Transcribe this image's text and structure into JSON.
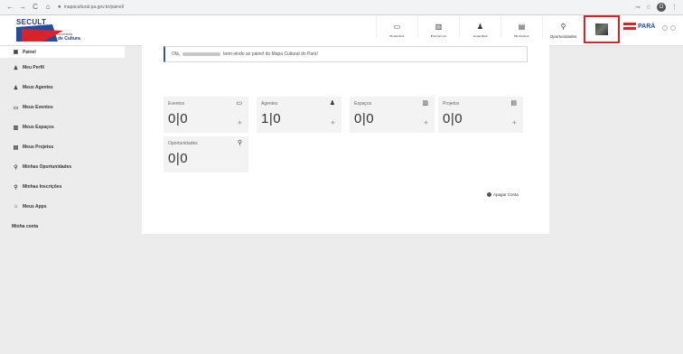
{
  "browser": {
    "url": "mapacultural.pa.gov.br/painel/",
    "nav": [
      "←",
      "→",
      "C",
      "⌂"
    ],
    "profile_initial": "O"
  },
  "header": {
    "logo_title": "SECULT",
    "logo_sub1": "Secretaria",
    "logo_sub2": "de Cultura",
    "nav": [
      {
        "label": "Eventos",
        "icon": "calendar-icon",
        "glyph": "▭"
      },
      {
        "label": "Espaços",
        "icon": "building-icon",
        "glyph": "▥"
      },
      {
        "label": "Agentes",
        "icon": "person-icon",
        "glyph": "♟"
      },
      {
        "label": "Projetos",
        "icon": "document-icon",
        "glyph": "▤"
      },
      {
        "label": "Oportunidades",
        "icon": "lightbulb-icon",
        "glyph": "⚲"
      }
    ],
    "state_logo": "PARÁ"
  },
  "sidebar": {
    "items": [
      {
        "label": "Painel",
        "icon": "dashboard-icon",
        "glyph": "▣"
      },
      {
        "label": "Meu Perfil",
        "icon": "person-icon",
        "glyph": "♟"
      },
      {
        "label": "Meus Agentes",
        "icon": "people-icon",
        "glyph": "♟"
      },
      {
        "label": "Meus Eventos",
        "icon": "calendar-icon",
        "glyph": "▭"
      },
      {
        "label": "Meus Espaços",
        "icon": "building-icon",
        "glyph": "▥"
      },
      {
        "label": "Meus Projetos",
        "icon": "document-icon",
        "glyph": "▤"
      },
      {
        "label": "Minhas Oportunidades",
        "icon": "lightbulb-icon",
        "glyph": "⚲"
      },
      {
        "label": "Minhas Inscrições",
        "icon": "lightbulb-icon",
        "glyph": "⚲"
      },
      {
        "label": "Meus Apps",
        "icon": "app-icon",
        "glyph": "⌂"
      },
      {
        "label": "Minha conta",
        "icon": "",
        "glyph": ""
      }
    ]
  },
  "welcome": {
    "prefix": "Olá,",
    "suffix": "bem-vindo ao painel do Mapa Cultural do Pará!"
  },
  "cards": [
    {
      "title": "Eventos",
      "value": "0|0",
      "icon": "calendar-icon",
      "glyph": "▭",
      "plus": "+"
    },
    {
      "title": "Agentes",
      "value": "1|0",
      "icon": "person-icon",
      "glyph": "♟",
      "plus": "+"
    },
    {
      "title": "Espaços",
      "value": "0|0",
      "icon": "building-icon",
      "glyph": "▥",
      "plus": "+"
    },
    {
      "title": "Projetos",
      "value": "0|0",
      "icon": "document-icon",
      "glyph": "▤",
      "plus": "+"
    },
    {
      "title": "Oportunidades",
      "value": "0|0",
      "icon": "lightbulb-icon",
      "glyph": "⚲",
      "plus": ""
    }
  ],
  "delete_account": "Apagar Conta"
}
